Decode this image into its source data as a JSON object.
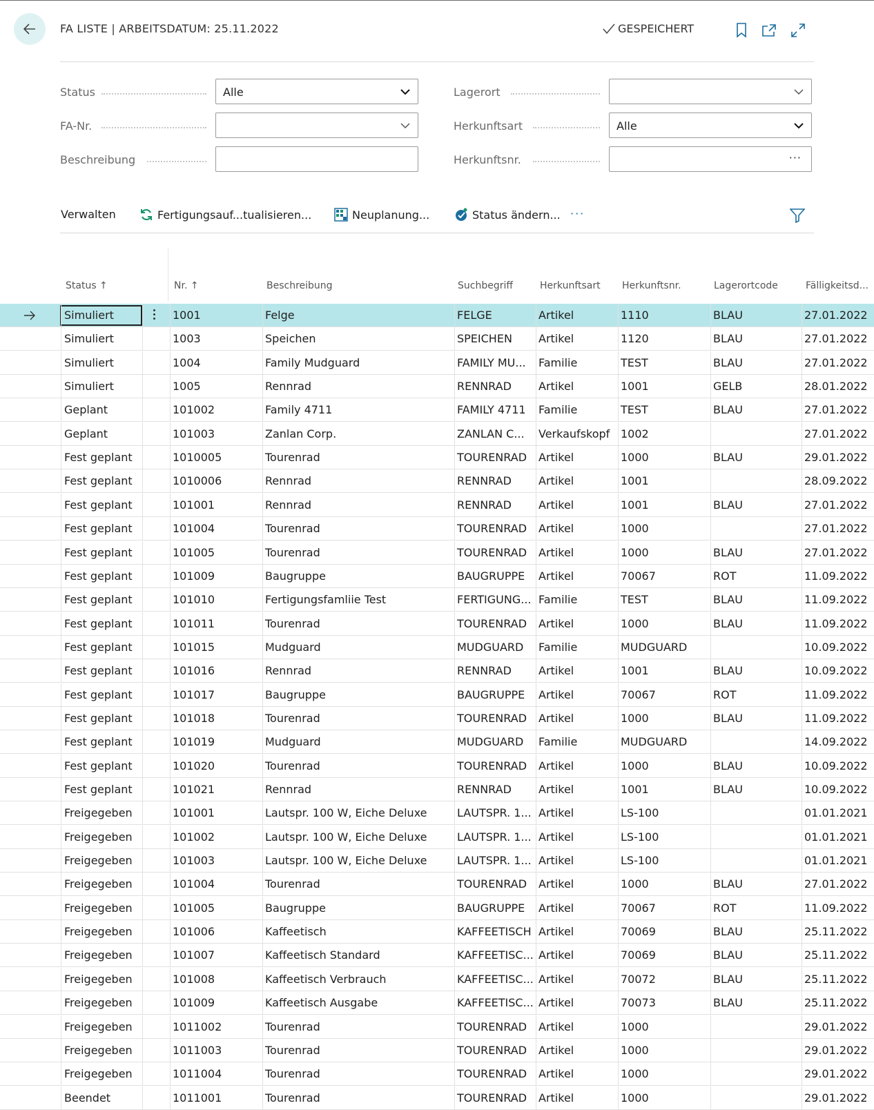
{
  "header": {
    "title": "FA LISTE | ARBEITSDATUM: 25.11.2022",
    "saved_label": "GESPEICHERT"
  },
  "filters": {
    "status": {
      "label": "Status",
      "value": "Alle"
    },
    "fa_nr": {
      "label": "FA-Nr.",
      "value": ""
    },
    "beschreibung": {
      "label": "Beschreibung",
      "value": ""
    },
    "lagerort": {
      "label": "Lagerort",
      "value": ""
    },
    "herkunftsart": {
      "label": "Herkunftsart",
      "value": "Alle"
    },
    "herkunftsnr": {
      "label": "Herkunftsnr.",
      "value": ""
    }
  },
  "actions": {
    "verwalten": "Verwalten",
    "refresh": "Fertigungsauf...tualisieren...",
    "replan": "Neuplanung...",
    "change_status": "Status ändern...",
    "more": "···"
  },
  "columns": [
    "Status ↑",
    "Nr. ↑",
    "Beschreibung",
    "Suchbegriff",
    "Herkunftsart",
    "Herkunftsnr.",
    "Lagerortcode",
    "Fälligkeitsd..."
  ],
  "rows": [
    [
      "Simuliert",
      "1001",
      "Felge",
      "FELGE",
      "Artikel",
      "1110",
      "BLAU",
      "27.01.2022"
    ],
    [
      "Simuliert",
      "1003",
      "Speichen",
      "SPEICHEN",
      "Artikel",
      "1120",
      "BLAU",
      "27.01.2022"
    ],
    [
      "Simuliert",
      "1004",
      "Family Mudguard",
      "FAMILY MU...",
      "Familie",
      "TEST",
      "BLAU",
      "27.01.2022"
    ],
    [
      "Simuliert",
      "1005",
      "Rennrad",
      "RENNRAD",
      "Artikel",
      "1001",
      "GELB",
      "28.01.2022"
    ],
    [
      "Geplant",
      "101002",
      "Family 4711",
      "FAMILY 4711",
      "Familie",
      "TEST",
      "BLAU",
      "27.01.2022"
    ],
    [
      "Geplant",
      "101003",
      "Zanlan Corp.",
      "ZANLAN C...",
      "Verkaufskopf",
      "1002",
      "",
      "27.01.2022"
    ],
    [
      "Fest geplant",
      "1010005",
      "Tourenrad",
      "TOURENRAD",
      "Artikel",
      "1000",
      "BLAU",
      "29.01.2022"
    ],
    [
      "Fest geplant",
      "1010006",
      "Rennrad",
      "RENNRAD",
      "Artikel",
      "1001",
      "",
      "28.09.2022"
    ],
    [
      "Fest geplant",
      "101001",
      "Rennrad",
      "RENNRAD",
      "Artikel",
      "1001",
      "BLAU",
      "27.01.2022"
    ],
    [
      "Fest geplant",
      "101004",
      "Tourenrad",
      "TOURENRAD",
      "Artikel",
      "1000",
      "",
      "27.01.2022"
    ],
    [
      "Fest geplant",
      "101005",
      "Tourenrad",
      "TOURENRAD",
      "Artikel",
      "1000",
      "BLAU",
      "27.01.2022"
    ],
    [
      "Fest geplant",
      "101009",
      "Baugruppe",
      "BAUGRUPPE",
      "Artikel",
      "70067",
      "ROT",
      "11.09.2022"
    ],
    [
      "Fest geplant",
      "101010",
      "Fertigungsfamliie Test",
      "FERTIGUNG...",
      "Familie",
      "TEST",
      "BLAU",
      "11.09.2022"
    ],
    [
      "Fest geplant",
      "101011",
      "Tourenrad",
      "TOURENRAD",
      "Artikel",
      "1000",
      "BLAU",
      "11.09.2022"
    ],
    [
      "Fest geplant",
      "101015",
      "Mudguard",
      "MUDGUARD",
      "Familie",
      "MUDGUARD",
      "",
      "10.09.2022"
    ],
    [
      "Fest geplant",
      "101016",
      "Rennrad",
      "RENNRAD",
      "Artikel",
      "1001",
      "BLAU",
      "10.09.2022"
    ],
    [
      "Fest geplant",
      "101017",
      "Baugruppe",
      "BAUGRUPPE",
      "Artikel",
      "70067",
      "ROT",
      "11.09.2022"
    ],
    [
      "Fest geplant",
      "101018",
      "Tourenrad",
      "TOURENRAD",
      "Artikel",
      "1000",
      "BLAU",
      "11.09.2022"
    ],
    [
      "Fest geplant",
      "101019",
      "Mudguard",
      "MUDGUARD",
      "Familie",
      "MUDGUARD",
      "",
      "14.09.2022"
    ],
    [
      "Fest geplant",
      "101020",
      "Tourenrad",
      "TOURENRAD",
      "Artikel",
      "1000",
      "BLAU",
      "10.09.2022"
    ],
    [
      "Fest geplant",
      "101021",
      "Rennrad",
      "RENNRAD",
      "Artikel",
      "1001",
      "BLAU",
      "10.09.2022"
    ],
    [
      "Freigegeben",
      "101001",
      "Lautspr. 100 W, Eiche Deluxe",
      "LAUTSPR. 1...",
      "Artikel",
      "LS-100",
      "",
      "01.01.2021"
    ],
    [
      "Freigegeben",
      "101002",
      "Lautspr. 100 W, Eiche Deluxe",
      "LAUTSPR. 1...",
      "Artikel",
      "LS-100",
      "",
      "01.01.2021"
    ],
    [
      "Freigegeben",
      "101003",
      "Lautspr. 100 W, Eiche Deluxe",
      "LAUTSPR. 1...",
      "Artikel",
      "LS-100",
      "",
      "01.01.2021"
    ],
    [
      "Freigegeben",
      "101004",
      "Tourenrad",
      "TOURENRAD",
      "Artikel",
      "1000",
      "BLAU",
      "27.01.2022"
    ],
    [
      "Freigegeben",
      "101005",
      "Baugruppe",
      "BAUGRUPPE",
      "Artikel",
      "70067",
      "ROT",
      "11.09.2022"
    ],
    [
      "Freigegeben",
      "101006",
      "Kaffeetisch",
      "KAFFEETISCH",
      "Artikel",
      "70069",
      "BLAU",
      "25.11.2022"
    ],
    [
      "Freigegeben",
      "101007",
      "Kaffeetisch Standard",
      "KAFFEETISC...",
      "Artikel",
      "70069",
      "BLAU",
      "25.11.2022"
    ],
    [
      "Freigegeben",
      "101008",
      "Kaffeetisch Verbrauch",
      "KAFFEETISC...",
      "Artikel",
      "70072",
      "BLAU",
      "25.11.2022"
    ],
    [
      "Freigegeben",
      "101009",
      "Kaffeetisch Ausgabe",
      "KAFFEETISC...",
      "Artikel",
      "70073",
      "BLAU",
      "25.11.2022"
    ],
    [
      "Freigegeben",
      "1011002",
      "Tourenrad",
      "TOURENRAD",
      "Artikel",
      "1000",
      "",
      "29.01.2022"
    ],
    [
      "Freigegeben",
      "1011003",
      "Tourenrad",
      "TOURENRAD",
      "Artikel",
      "1000",
      "",
      "29.01.2022"
    ],
    [
      "Freigegeben",
      "1011004",
      "Tourenrad",
      "TOURENRAD",
      "Artikel",
      "1000",
      "",
      "29.01.2022"
    ],
    [
      "Beendet",
      "1011001",
      "Tourenrad",
      "TOURENRAD",
      "Artikel",
      "1000",
      "",
      "29.01.2022"
    ]
  ],
  "colors": {
    "accent": "#1b6e9f",
    "selected_row": "#b7e6ea",
    "back_button": "#dff2f3"
  }
}
